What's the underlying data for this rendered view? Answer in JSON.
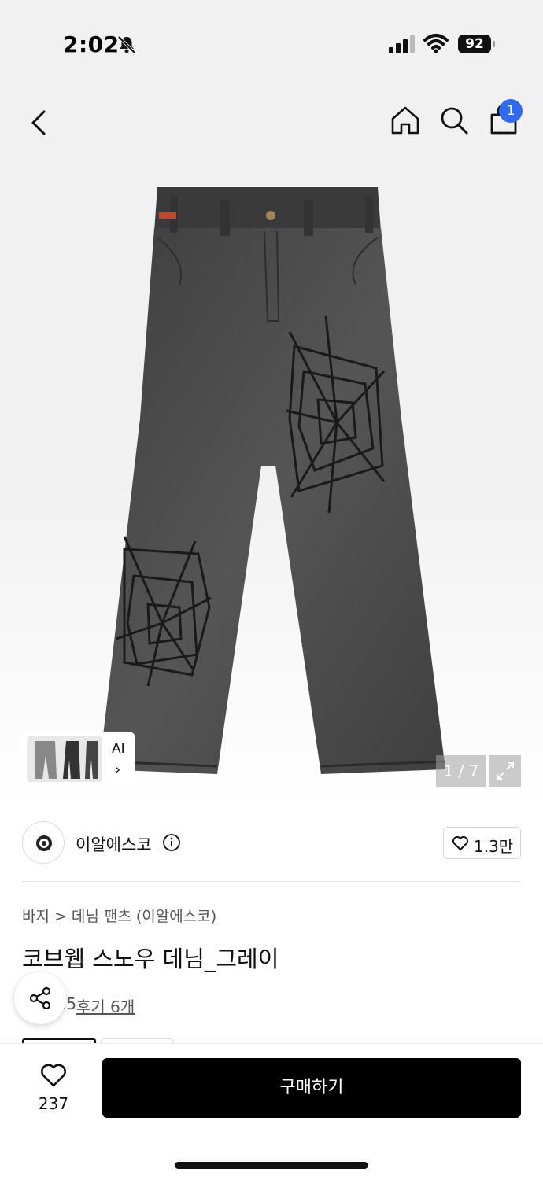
{
  "status": {
    "time": "2:02",
    "battery": "92",
    "bell_icon": "bell-slash-icon"
  },
  "nav": {
    "back_icon": "chevron-left-icon",
    "home_icon": "home-icon",
    "search_icon": "search-icon",
    "bag_icon": "shopping-bag-icon",
    "bag_badge": "1"
  },
  "gallery": {
    "counter": "1 / 7",
    "ai_label": "AI",
    "ai_arrow": "›"
  },
  "seller": {
    "name": "이알에스코",
    "likes": "1.3만"
  },
  "product": {
    "breadcrumb": [
      "바지",
      "데님 팬츠 (이알에스코)"
    ],
    "title": "코브웹 스노우 데님_그레이",
    "rating": ".5",
    "reviews": "후기 6개"
  },
  "bottom": {
    "wish_count": "237",
    "buy_label": "구매하기"
  },
  "colors": {
    "badge": "#2f6bf2",
    "buy_button": "#000000",
    "denim": "#4a4a4a"
  }
}
